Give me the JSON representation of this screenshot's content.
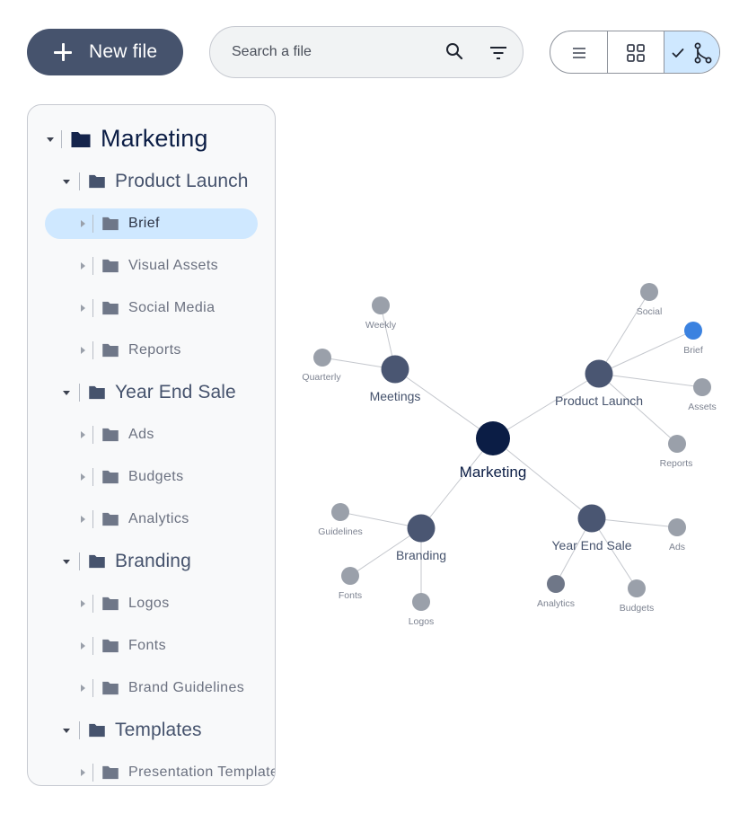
{
  "toolbar": {
    "new_file_label": "New file",
    "search_placeholder": "Search a file",
    "view_modes": [
      "list",
      "grid",
      "graph"
    ],
    "active_view": "graph"
  },
  "tree": [
    {
      "label": "Marketing",
      "level": 0,
      "expanded": true
    },
    {
      "label": "Product Launch",
      "level": 1,
      "expanded": true
    },
    {
      "label": "Brief",
      "level": 2,
      "expanded": false,
      "selected": true
    },
    {
      "label": "Visual Assets",
      "level": 2,
      "expanded": false
    },
    {
      "label": "Social Media",
      "level": 2,
      "expanded": false
    },
    {
      "label": "Reports",
      "level": 2,
      "expanded": false
    },
    {
      "label": "Year End Sale",
      "level": 1,
      "expanded": true
    },
    {
      "label": "Ads",
      "level": 2,
      "expanded": false
    },
    {
      "label": "Budgets",
      "level": 2,
      "expanded": false
    },
    {
      "label": "Analytics",
      "level": 2,
      "expanded": false
    },
    {
      "label": "Branding",
      "level": 1,
      "expanded": true
    },
    {
      "label": "Logos",
      "level": 2,
      "expanded": false
    },
    {
      "label": "Fonts",
      "level": 2,
      "expanded": false
    },
    {
      "label": "Brand Guidelines",
      "level": 2,
      "expanded": false
    },
    {
      "label": "Templates",
      "level": 1,
      "expanded": true
    },
    {
      "label": "Presentation Templates",
      "level": 2,
      "expanded": false
    }
  ],
  "graph": {
    "nodes": [
      {
        "id": "marketing",
        "label": "Marketing",
        "kind": "root"
      },
      {
        "id": "meetings",
        "label": "Meetings",
        "kind": "branch"
      },
      {
        "id": "product_launch",
        "label": "Product Launch",
        "kind": "branch"
      },
      {
        "id": "branding",
        "label": "Branding",
        "kind": "branch"
      },
      {
        "id": "year_end_sale",
        "label": "Year End Sale",
        "kind": "branch"
      },
      {
        "id": "weekly",
        "label": "Weekly",
        "kind": "leaf"
      },
      {
        "id": "quarterly",
        "label": "Quarterly",
        "kind": "leaf"
      },
      {
        "id": "social",
        "label": "Social",
        "kind": "leaf"
      },
      {
        "id": "brief",
        "label": "Brief",
        "kind": "leaf",
        "highlighted": true
      },
      {
        "id": "assets",
        "label": "Assets",
        "kind": "leaf"
      },
      {
        "id": "reports",
        "label": "Reports",
        "kind": "leaf"
      },
      {
        "id": "guidelines",
        "label": "Guidelines",
        "kind": "leaf"
      },
      {
        "id": "fonts",
        "label": "Fonts",
        "kind": "leaf"
      },
      {
        "id": "logos",
        "label": "Logos",
        "kind": "leaf"
      },
      {
        "id": "ads",
        "label": "Ads",
        "kind": "leaf"
      },
      {
        "id": "analytics",
        "label": "Analytics",
        "kind": "leaf"
      },
      {
        "id": "budgets",
        "label": "Budgets",
        "kind": "leaf"
      }
    ],
    "edges": [
      [
        "marketing",
        "meetings"
      ],
      [
        "marketing",
        "product_launch"
      ],
      [
        "marketing",
        "branding"
      ],
      [
        "marketing",
        "year_end_sale"
      ],
      [
        "meetings",
        "weekly"
      ],
      [
        "meetings",
        "quarterly"
      ],
      [
        "product_launch",
        "social"
      ],
      [
        "product_launch",
        "brief"
      ],
      [
        "product_launch",
        "assets"
      ],
      [
        "product_launch",
        "reports"
      ],
      [
        "branding",
        "guidelines"
      ],
      [
        "branding",
        "fonts"
      ],
      [
        "branding",
        "logos"
      ],
      [
        "year_end_sale",
        "ads"
      ],
      [
        "year_end_sale",
        "analytics"
      ],
      [
        "year_end_sale",
        "budgets"
      ]
    ]
  },
  "colors": {
    "primary_button": "#46536d",
    "root_node": "#0b1d45",
    "branch_node": "#4a5672",
    "leaf_node": "#9aa0aa",
    "highlight_node": "#3b82e0",
    "selection": "#cfe8ff",
    "folder_top": "#14244b",
    "folder_mid": "#46536d",
    "folder_leaf": "#6f7788"
  },
  "icons": {
    "new_file": "plus-icon",
    "search": "search-icon",
    "filter": "filter-icon",
    "list_view": "list-view-icon",
    "grid_view": "grid-view-icon",
    "graph_view": "graph-view-icon",
    "check": "check-icon",
    "folder": "folder-icon",
    "expand": "caret-icon"
  }
}
